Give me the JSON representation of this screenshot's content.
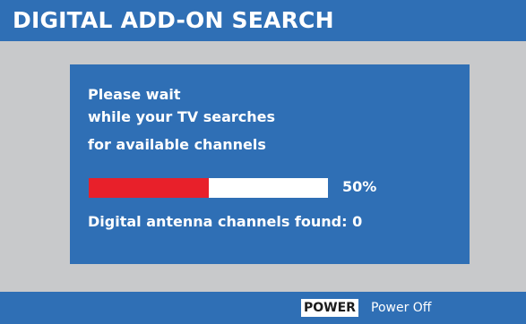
{
  "header": {
    "title": "DIGITAL ADD-ON SEARCH"
  },
  "dialog": {
    "lines": [
      "Please wait",
      "while your TV searches",
      "for available channels"
    ],
    "progress": {
      "percent_value": 50,
      "percent_label": "50%"
    },
    "channels_found": "Digital antenna channels found: 0"
  },
  "footer": {
    "power_key": "POWER",
    "power_action": "Power Off"
  },
  "colors": {
    "panel_blue": "#2f6fb5",
    "background_gray": "#c8c9cb",
    "progress_red": "#e8202a",
    "progress_track": "#ffffff"
  }
}
